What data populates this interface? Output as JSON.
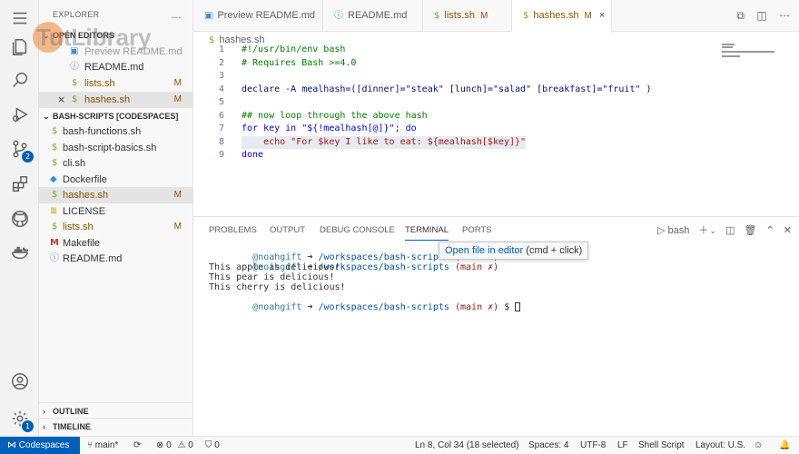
{
  "explorer": {
    "title": "EXPLORER",
    "more": "…"
  },
  "open_editors": {
    "header": "OPEN EDITORS",
    "items": [
      {
        "label": "Preview README.md",
        "modified": "",
        "icon": "preview"
      },
      {
        "label": "README.md",
        "modified": "",
        "icon": "info"
      },
      {
        "label": "lists.sh",
        "modified": "M",
        "icon": "dollar"
      },
      {
        "label": "hashes.sh",
        "modified": "M",
        "icon": "dollar",
        "close": "×"
      }
    ]
  },
  "workspace": {
    "header": "BASH-SCRIPTS [CODESPACES]",
    "files": [
      {
        "label": "bash-functions.sh",
        "modified": "",
        "icon": "dollar"
      },
      {
        "label": "bash-script-basics.sh",
        "modified": "",
        "icon": "dollar"
      },
      {
        "label": "cli.sh",
        "modified": "",
        "icon": "dollar"
      },
      {
        "label": "Dockerfile",
        "modified": "",
        "icon": "docker"
      },
      {
        "label": "hashes.sh",
        "modified": "M",
        "icon": "dollar"
      },
      {
        "label": "LICENSE",
        "modified": "",
        "icon": "license"
      },
      {
        "label": "lists.sh",
        "modified": "M",
        "icon": "dollar"
      },
      {
        "label": "Makefile",
        "modified": "",
        "icon": "makefile"
      },
      {
        "label": "README.md",
        "modified": "",
        "icon": "info"
      }
    ]
  },
  "outline": "OUTLINE",
  "timeline": "TIMELINE",
  "tabs": [
    {
      "label": "Preview README.md",
      "modified": "",
      "icon": "preview"
    },
    {
      "label": "README.md",
      "modified": "",
      "icon": "info"
    },
    {
      "label": "lists.sh",
      "modified": "M",
      "icon": "dollar"
    },
    {
      "label": "hashes.sh",
      "modified": "M",
      "icon": "dollar",
      "close": "×"
    }
  ],
  "breadcrumb": "hashes.sh",
  "code": [
    "#!/usr/bin/env bash",
    "# Requires Bash >=4.0",
    "",
    "declare -A mealhash=([dinner]=\"steak\" [lunch]=\"salad\" [breakfast]=\"fruit\" )",
    "",
    "## now loop through the above hash",
    "for key in \"${!mealhash[@]}\"; do",
    "    echo \"For $key I like to eat: ${mealhash[$key]}\"",
    "done"
  ],
  "line_numbers": [
    "1",
    "2",
    "3",
    "4",
    "5",
    "6",
    "7",
    "8",
    "9"
  ],
  "panel": {
    "tabs": [
      "PROBLEMS",
      "OUTPUT",
      "DEBUG CONSOLE",
      "TERMINAL",
      "PORTS"
    ],
    "active": "TERMINAL",
    "shell": "bash"
  },
  "terminal": {
    "user": "@noahgift",
    "arrow": "➜",
    "path": "/workspaces/bash-scripts",
    "branch": "(main ✗)",
    "prompt": "$",
    "outputs": [
      "This apple is delicious!",
      "This pear is delicious!",
      "This cherry is delicious!"
    ]
  },
  "tooltip": {
    "link": "Open file in editor",
    "hint": "(cmd + click)"
  },
  "status": {
    "remote": "Codespaces",
    "branch": "main*",
    "errors": "0",
    "warnings": "0",
    "ports": "0",
    "position": "Ln 8, Col 34 (18 selected)",
    "spaces": "Spaces: 4",
    "encoding": "UTF-8",
    "eol": "LF",
    "language": "Shell Script",
    "layout": "Layout: U.S."
  },
  "accounts_badge": "1",
  "scm_badge": "2"
}
